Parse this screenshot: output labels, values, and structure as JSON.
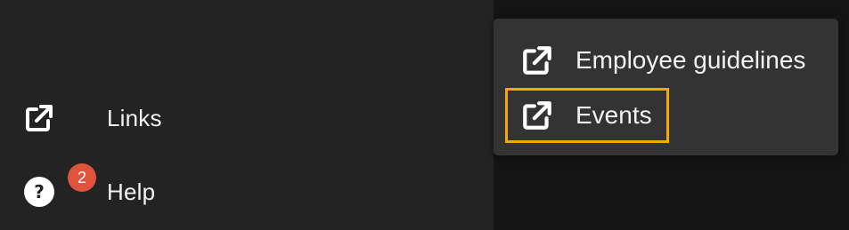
{
  "sidebar": {
    "items": [
      {
        "label": "Links",
        "icon": "external-link-icon"
      },
      {
        "label": "Help",
        "icon": "help-icon",
        "icon_glyph": "?",
        "badge": "2"
      }
    ]
  },
  "menu": {
    "items": [
      {
        "label": "Employee guidelines",
        "icon": "external-link-icon"
      },
      {
        "label": "Events",
        "icon": "external-link-icon",
        "focused": true
      }
    ]
  },
  "colors": {
    "sidebar_bg": "#232323",
    "page_bg": "#141414",
    "menu_bg": "#333333",
    "badge": "#e0533c",
    "focus": "#f5a800",
    "text": "#f2f2f2"
  }
}
